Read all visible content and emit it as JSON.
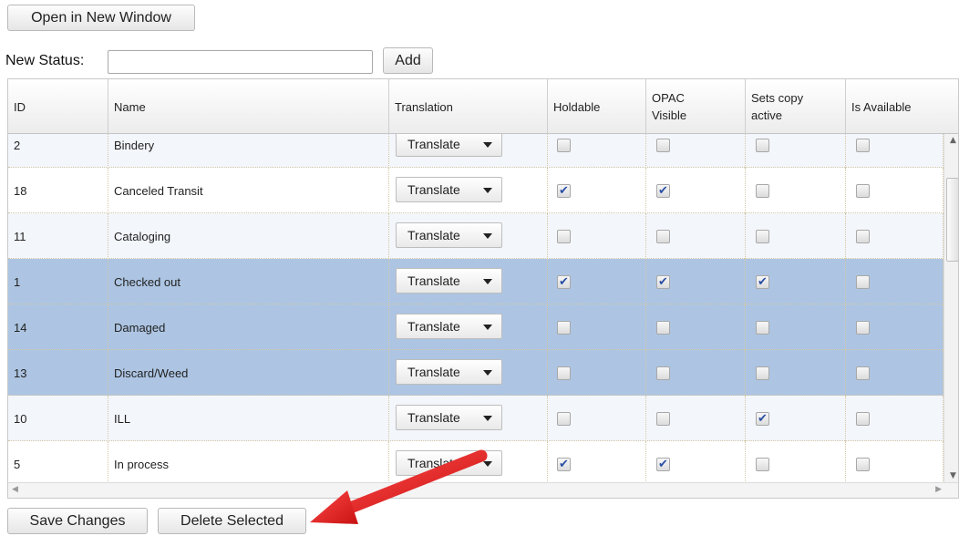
{
  "toolbar": {
    "open_label": "Open in New Window",
    "new_status_label": "New Status:",
    "new_status_value": "",
    "add_label": "Add"
  },
  "grid": {
    "columns": [
      "ID",
      "Name",
      "Translation",
      "Holdable",
      "OPAC Visible",
      "Sets copy active",
      "Is Available"
    ],
    "translate_label": "Translate",
    "rows": [
      {
        "id": "2",
        "name": "Bindery",
        "holdable": false,
        "opac_visible": false,
        "sets_copy_active": false,
        "is_available": false,
        "selected": false
      },
      {
        "id": "18",
        "name": "Canceled Transit",
        "holdable": true,
        "opac_visible": true,
        "sets_copy_active": false,
        "is_available": false,
        "selected": false
      },
      {
        "id": "11",
        "name": "Cataloging",
        "holdable": false,
        "opac_visible": false,
        "sets_copy_active": false,
        "is_available": false,
        "selected": false
      },
      {
        "id": "1",
        "name": "Checked out",
        "holdable": true,
        "opac_visible": true,
        "sets_copy_active": true,
        "is_available": false,
        "selected": true
      },
      {
        "id": "14",
        "name": "Damaged",
        "holdable": false,
        "opac_visible": false,
        "sets_copy_active": false,
        "is_available": false,
        "selected": true
      },
      {
        "id": "13",
        "name": "Discard/Weed",
        "holdable": false,
        "opac_visible": false,
        "sets_copy_active": false,
        "is_available": false,
        "selected": true
      },
      {
        "id": "10",
        "name": "ILL",
        "holdable": false,
        "opac_visible": false,
        "sets_copy_active": true,
        "is_available": false,
        "selected": false
      },
      {
        "id": "5",
        "name": "In process",
        "holdable": true,
        "opac_visible": true,
        "sets_copy_active": false,
        "is_available": false,
        "selected": false
      }
    ]
  },
  "footer": {
    "save_label": "Save Changes",
    "delete_label": "Delete Selected"
  },
  "colors": {
    "selected_row": "#adc5e3",
    "check_mark": "#2a4fa5",
    "annotation_arrow": "#e02020"
  },
  "icons": {
    "dropdown": "caret-down-icon",
    "checked": "check-icon",
    "annotation": "red-arrow-icon"
  }
}
